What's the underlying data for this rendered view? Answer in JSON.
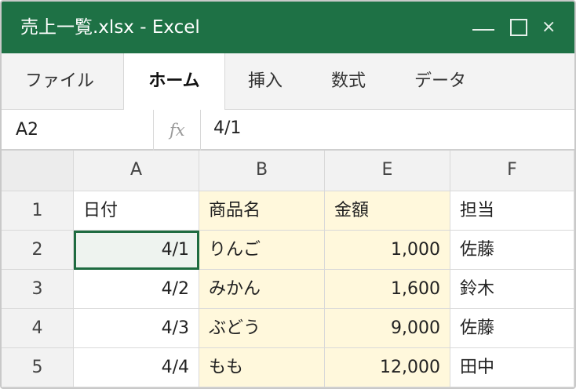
{
  "window": {
    "title": "売上一覧.xlsx - Excel",
    "controls": {
      "minimize": "—",
      "maximize": "□",
      "close": "×"
    }
  },
  "ribbon": {
    "tabs": [
      {
        "label": "ファイル",
        "active": false
      },
      {
        "label": "ホーム",
        "active": true
      },
      {
        "label": "挿入",
        "active": false
      },
      {
        "label": "数式",
        "active": false
      },
      {
        "label": "データ",
        "active": false
      }
    ]
  },
  "formula_bar": {
    "name_box": "A2",
    "fx_label": "fx",
    "value": "4/1"
  },
  "sheet": {
    "columns": [
      "A",
      "B",
      "E",
      "F"
    ],
    "rows": [
      {
        "num": "1",
        "cells": [
          "日付",
          "商品名",
          "金額",
          "担当"
        ]
      },
      {
        "num": "2",
        "cells": [
          "4/1",
          "りんご",
          "1,000",
          "佐藤"
        ]
      },
      {
        "num": "3",
        "cells": [
          "4/2",
          "みかん",
          "1,600",
          "鈴木"
        ]
      },
      {
        "num": "4",
        "cells": [
          "4/3",
          "ぶどう",
          "9,000",
          "佐藤"
        ]
      },
      {
        "num": "5",
        "cells": [
          "4/4",
          "もも",
          "12,000",
          "田中"
        ]
      }
    ],
    "selected_cell": "A2",
    "colors": {
      "header_green": "#1e7145",
      "highlight_fill": "#fff8dc",
      "selection_border": "#1e6b40"
    }
  }
}
